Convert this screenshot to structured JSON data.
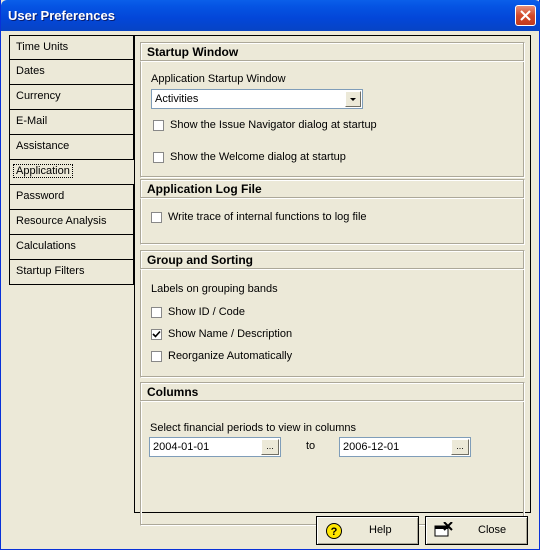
{
  "window": {
    "title": "User Preferences"
  },
  "sidebar": {
    "items": [
      {
        "label": "Time Units"
      },
      {
        "label": "Dates"
      },
      {
        "label": "Currency"
      },
      {
        "label": "E-Mail"
      },
      {
        "label": "Assistance"
      },
      {
        "label": "Application"
      },
      {
        "label": "Password"
      },
      {
        "label": "Resource Analysis"
      },
      {
        "label": "Calculations"
      },
      {
        "label": "Startup Filters"
      }
    ],
    "active": "Application"
  },
  "startup": {
    "title": "Startup Window",
    "select_label": "Application Startup Window",
    "select_value": "Activities",
    "chk_issue": "Show the Issue Navigator dialog at startup",
    "chk_welcome": "Show the Welcome dialog at startup"
  },
  "logfile": {
    "title": "Application Log File",
    "chk_trace": "Write trace of internal functions to log file"
  },
  "grouping": {
    "title": "Group and Sorting",
    "subtitle": "Labels on grouping bands",
    "chk_id": "Show ID / Code",
    "chk_name": "Show Name / Description",
    "chk_reorg": "Reorganize Automatically"
  },
  "columns": {
    "title": "Columns",
    "desc": "Select financial periods to view in columns",
    "from": "2004-01-01",
    "to_label": "to",
    "to": "2006-12-01",
    "ellipsis": "..."
  },
  "buttons": {
    "help": "Help",
    "close": "Close"
  },
  "state": {
    "issue_checked": false,
    "welcome_checked": false,
    "trace_checked": false,
    "id_checked": false,
    "name_checked": true,
    "reorg_checked": false
  }
}
